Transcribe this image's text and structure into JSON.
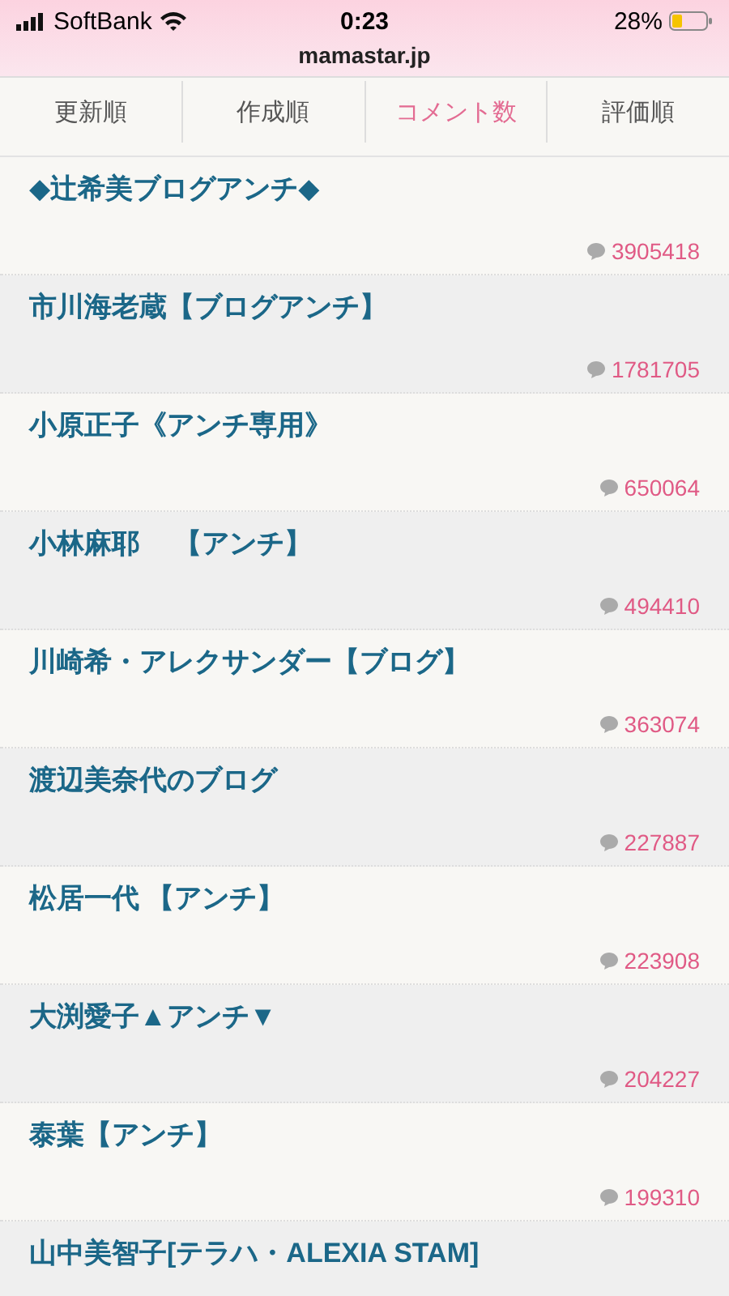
{
  "status_bar": {
    "carrier": "SoftBank",
    "time": "0:23",
    "battery": "28%",
    "url": "mamastar.jp"
  },
  "tabs": [
    {
      "label": "更新順",
      "selected": false
    },
    {
      "label": "作成順",
      "selected": false
    },
    {
      "label": "コメント数",
      "selected": true
    },
    {
      "label": "評価順",
      "selected": false
    }
  ],
  "rows": [
    {
      "title": "◆辻希美ブログアンチ◆",
      "count": "3905418"
    },
    {
      "title": "市川海老蔵【ブログアンチ】",
      "count": "1781705"
    },
    {
      "title": "小原正子《アンチ専用》",
      "count": "650064"
    },
    {
      "title": "小林麻耶　 【アンチ】",
      "count": "494410"
    },
    {
      "title": "川崎希・アレクサンダー【ブログ】",
      "count": "363074"
    },
    {
      "title": "渡辺美奈代のブログ",
      "count": "227887"
    },
    {
      "title": "松居一代 【アンチ】",
      "count": "223908"
    },
    {
      "title": "大渕愛子▲アンチ▼",
      "count": "204227"
    },
    {
      "title": "泰葉【アンチ】",
      "count": "199310"
    },
    {
      "title": "山中美智子[テラハ・ALEXIA STAM]"
    }
  ]
}
